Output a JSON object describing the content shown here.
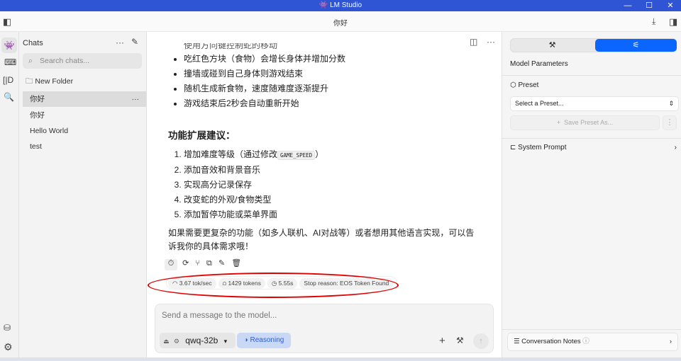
{
  "window": {
    "app_title": "LM Studio",
    "chat_title": "你好"
  },
  "sidebar": {
    "heading": "Chats",
    "search_placeholder": "Search chats...",
    "new_folder": "New Folder",
    "chats": [
      {
        "label": "你好",
        "active": true
      },
      {
        "label": "你好"
      },
      {
        "label": "Hello World"
      },
      {
        "label": "test"
      }
    ]
  },
  "message": {
    "clipped_bullet": "使用方向键控制蛇的移动",
    "bullets": [
      "吃红色方块（食物）会增长身体并增加分数",
      "撞墙或碰到自己身体则游戏结束",
      "随机生成新食物，速度随难度逐渐提升",
      "游戏结束后2秒会自动重新开始"
    ],
    "heading": "功能扩展建议：",
    "numbered": [
      {
        "text": "增加难度等级（通过修改",
        "code": "GAME_SPEED",
        "after": "）"
      },
      {
        "text": "添加音效和背景音乐"
      },
      {
        "text": "实现高分记录保存"
      },
      {
        "text": "改变蛇的外观/食物类型"
      },
      {
        "text": "添加暂停功能或菜单界面"
      }
    ],
    "closing": "如果需要更复杂的功能（如多人联机、AI对战等）或者想用其他语言实现，可以告诉我你的具体需求哦！",
    "stats": {
      "speed": "3.67 tok/sec",
      "tokens": "1429 tokens",
      "time": "5.55s",
      "stop_reason": "Stop reason: EOS Token Found"
    }
  },
  "composer": {
    "placeholder": "Send a message to the model...",
    "model": "qwq-32b",
    "reasoning": "Reasoning"
  },
  "right_panel": {
    "section_title": "Model Parameters",
    "preset_label": "Preset",
    "preset_select": "Select a Preset...",
    "save_preset": "Save Preset As...",
    "system_prompt": "System Prompt",
    "notes": "Conversation Notes"
  },
  "colors": {
    "titlebar": "#2f55d4",
    "accent": "#0a66ff",
    "annotation": "#e00000"
  }
}
